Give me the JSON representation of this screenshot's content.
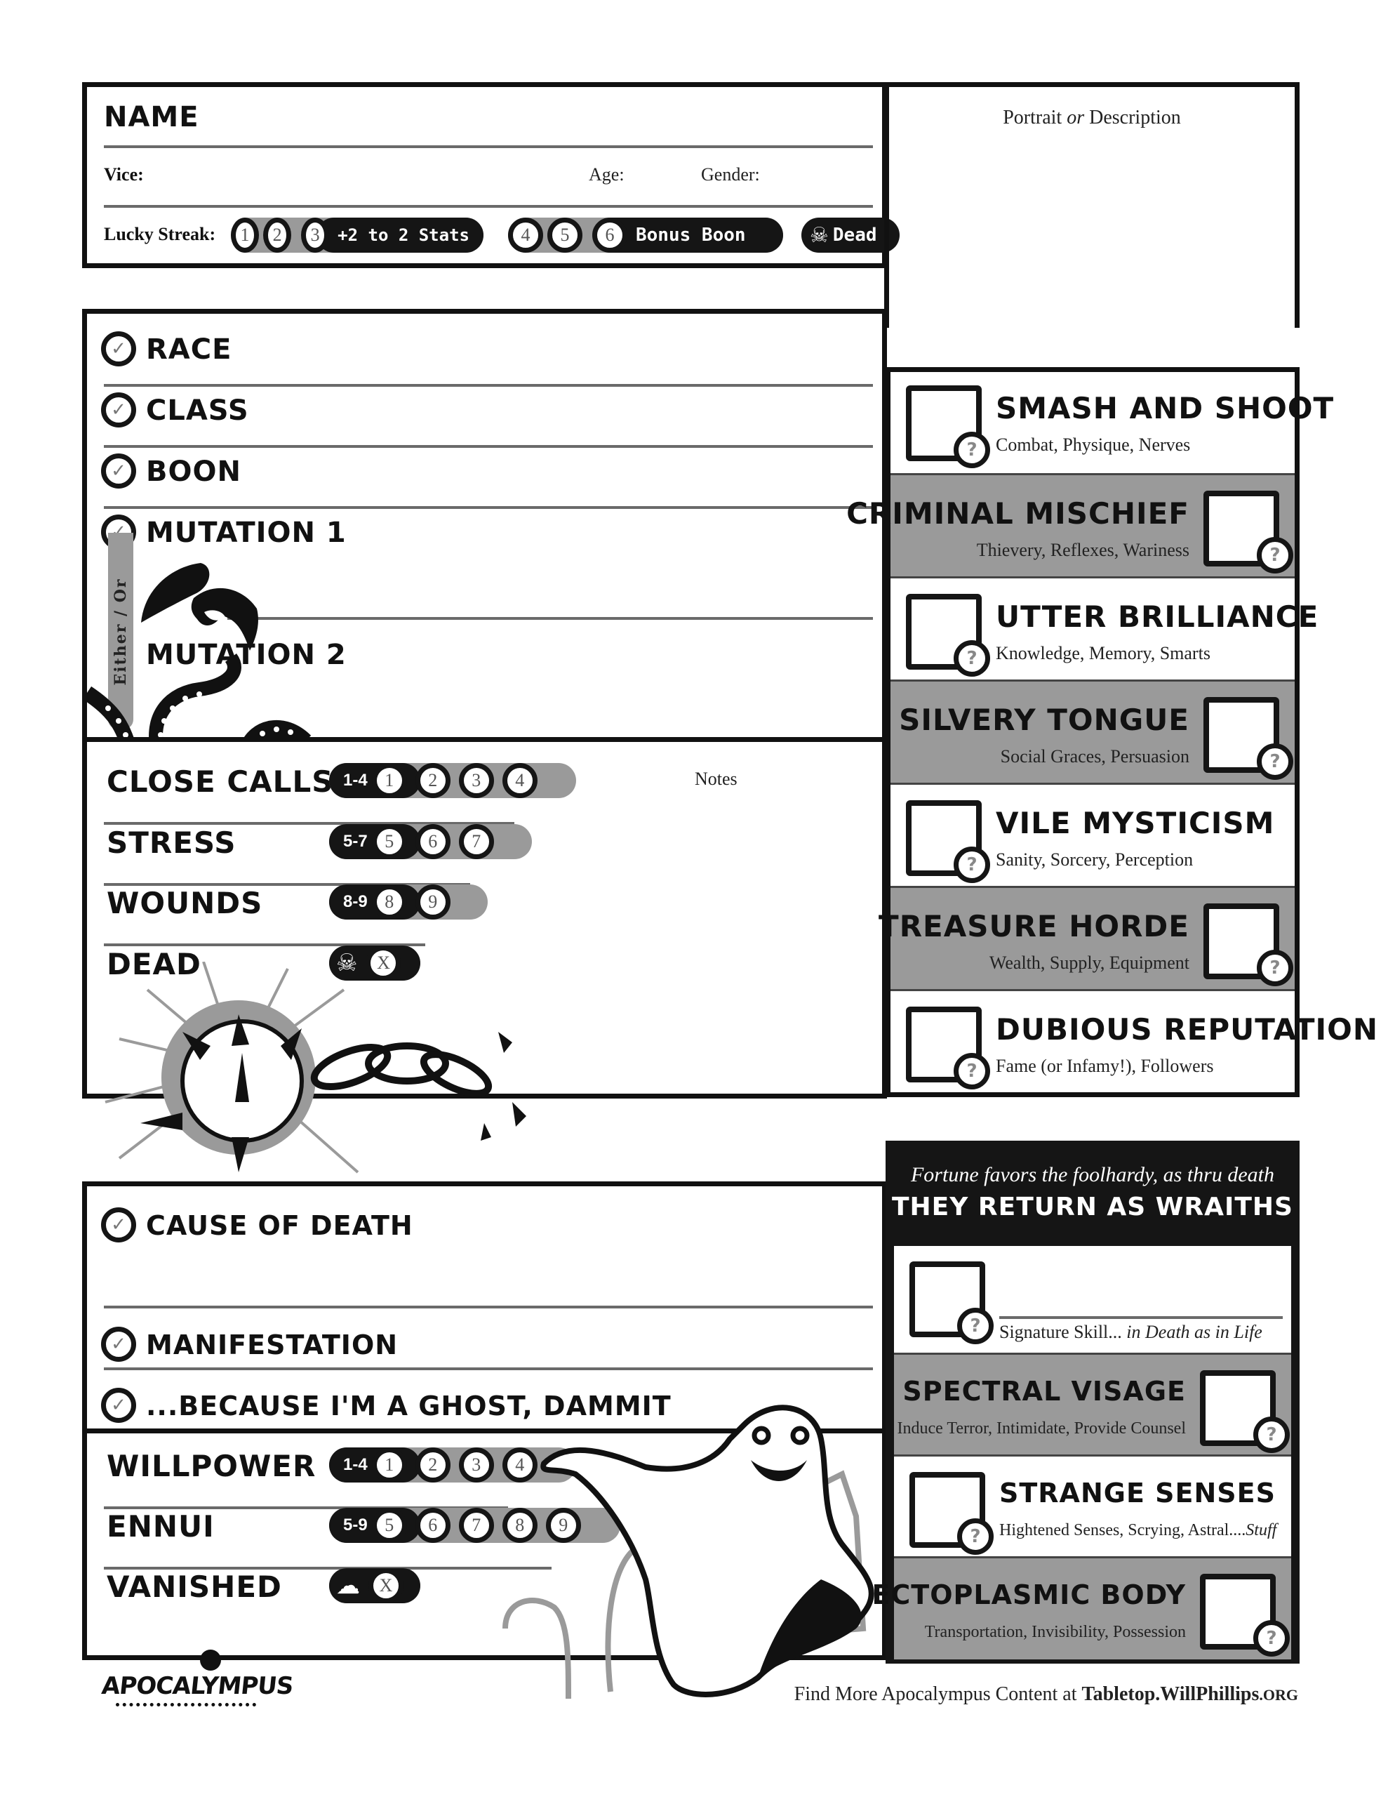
{
  "header": {
    "name_label": "NAME",
    "vice_label": "Vice:",
    "age_label": "Age:",
    "gender_label": "Gender:",
    "lucky_streak_label": "Lucky Streak:",
    "lucky_streak": {
      "group1": [
        "1",
        "2",
        "3"
      ],
      "group1_reward": "+2 to 2 Stats",
      "group2": [
        "4",
        "5",
        "6"
      ],
      "group2_reward": "Bonus Boon",
      "dead_label": "Dead"
    }
  },
  "portrait": {
    "label_pre": "Portrait",
    "label_or": "or",
    "label_post": "Description"
  },
  "identity": {
    "rows": [
      {
        "label": "RACE"
      },
      {
        "label": "CLASS"
      },
      {
        "label": "BOON"
      },
      {
        "label": "MUTATION 1"
      },
      {
        "label": "MUTATION 2"
      }
    ],
    "either_or": "Either / Or"
  },
  "stats": {
    "notes_label": "Notes",
    "tracks": [
      {
        "name": "CLOSE CALLS",
        "range": "1-4",
        "boxes": [
          "1",
          "2",
          "3",
          "4"
        ]
      },
      {
        "name": "STRESS",
        "range": "5-7",
        "boxes": [
          "5",
          "6",
          "7"
        ]
      },
      {
        "name": "WOUNDS",
        "range": "8-9",
        "boxes": [
          "8",
          "9"
        ]
      },
      {
        "name": "DEAD",
        "range": "",
        "boxes": [
          "X"
        ]
      }
    ]
  },
  "skills": [
    {
      "name": "SMASH AND SHOOT",
      "desc": "Combat, Physique, Nerves"
    },
    {
      "name": "CRIMINAL MISCHIEF",
      "desc": "Thievery, Reflexes, Wariness"
    },
    {
      "name": "UTTER BRILLIANCE",
      "desc": "Knowledge, Memory, Smarts"
    },
    {
      "name": "SILVERY TONGUE",
      "desc": "Social Graces, Persuasion"
    },
    {
      "name": "VILE MYSTICISM",
      "desc": "Sanity, Sorcery, Perception"
    },
    {
      "name": "TREASURE HORDE",
      "desc": "Wealth, Supply, Equipment"
    },
    {
      "name": "DUBIOUS REPUTATION",
      "desc": "Fame (or Infamy!), Followers"
    }
  ],
  "wraith": {
    "subtitle": "Fortune favors the foolhardy, as thru death",
    "title": "THEY RETURN AS WRAITHS",
    "signature_label": "Signature Skill...",
    "signature_italic": "in Death as in Life",
    "skills": [
      {
        "name": "SPECTRAL VISAGE",
        "desc": "Induce Terror, Intimidate, Provide Counsel"
      },
      {
        "name": "STRANGE SENSES",
        "desc": "Hightened Senses, Scrying, Astral....",
        "desc_italic": "Stuff"
      },
      {
        "name": "ECTOPLASMIC BODY",
        "desc": "Transportation, Invisibility, Possession"
      }
    ]
  },
  "death": {
    "rows": [
      {
        "label": "CAUSE OF DEATH"
      },
      {
        "label": "MANIFESTATION"
      },
      {
        "label": "...BECAUSE I'M A GHOST, DAMMIT"
      }
    ],
    "tracks": [
      {
        "name": "WILLPOWER",
        "range": "1-4",
        "boxes": [
          "1",
          "2",
          "3",
          "4"
        ]
      },
      {
        "name": "ENNUI",
        "range": "5-9",
        "boxes": [
          "5",
          "6",
          "7",
          "8",
          "9"
        ]
      },
      {
        "name": "VANISHED",
        "range": "",
        "boxes": [
          "X"
        ]
      }
    ]
  },
  "footer": {
    "logo": "APOCALYMPUS",
    "text": "Find More Apocalympus Content at",
    "link": "Tabletop.WillPhillips",
    "link_tld": ".ORG"
  },
  "colors": {
    "ink": "#111111",
    "grey": "#9a9a9a",
    "rule": "#6a6a6a"
  }
}
